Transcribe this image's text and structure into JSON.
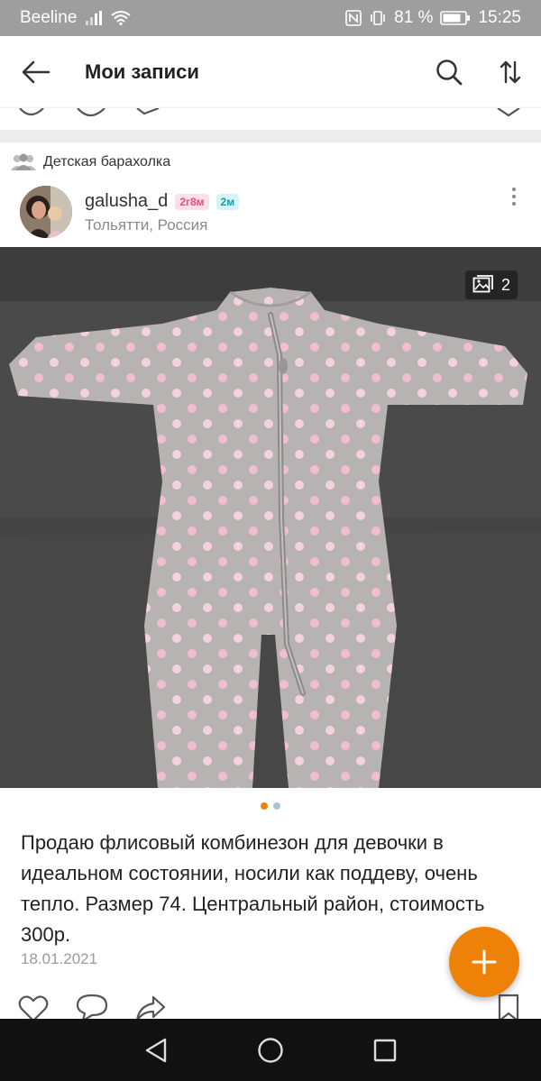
{
  "status_bar": {
    "carrier": "Beeline",
    "battery": "81 %",
    "time": "15:25"
  },
  "app_bar": {
    "title": "Мои записи"
  },
  "group": {
    "name": "Детская барахолка"
  },
  "author": {
    "name": "galusha_d",
    "badge_age_1": "2г8м",
    "badge_age_2": "2м",
    "location": "Тольятти, Россия"
  },
  "photo": {
    "count": "2",
    "total_images": 2,
    "current_index": 1
  },
  "post": {
    "text": "Продаю флисовый комбинезон для девочки в идеальном состоянии, носили как поддеву, очень тепло. Размер 74. Центральный район, стоимость 300р.",
    "date": "18.01.2021"
  },
  "colors": {
    "accent": "#ee8208",
    "status_bar": "#9e9e9e",
    "dot_active": "#ee8208",
    "dot_inactive": "#a9c5da"
  }
}
